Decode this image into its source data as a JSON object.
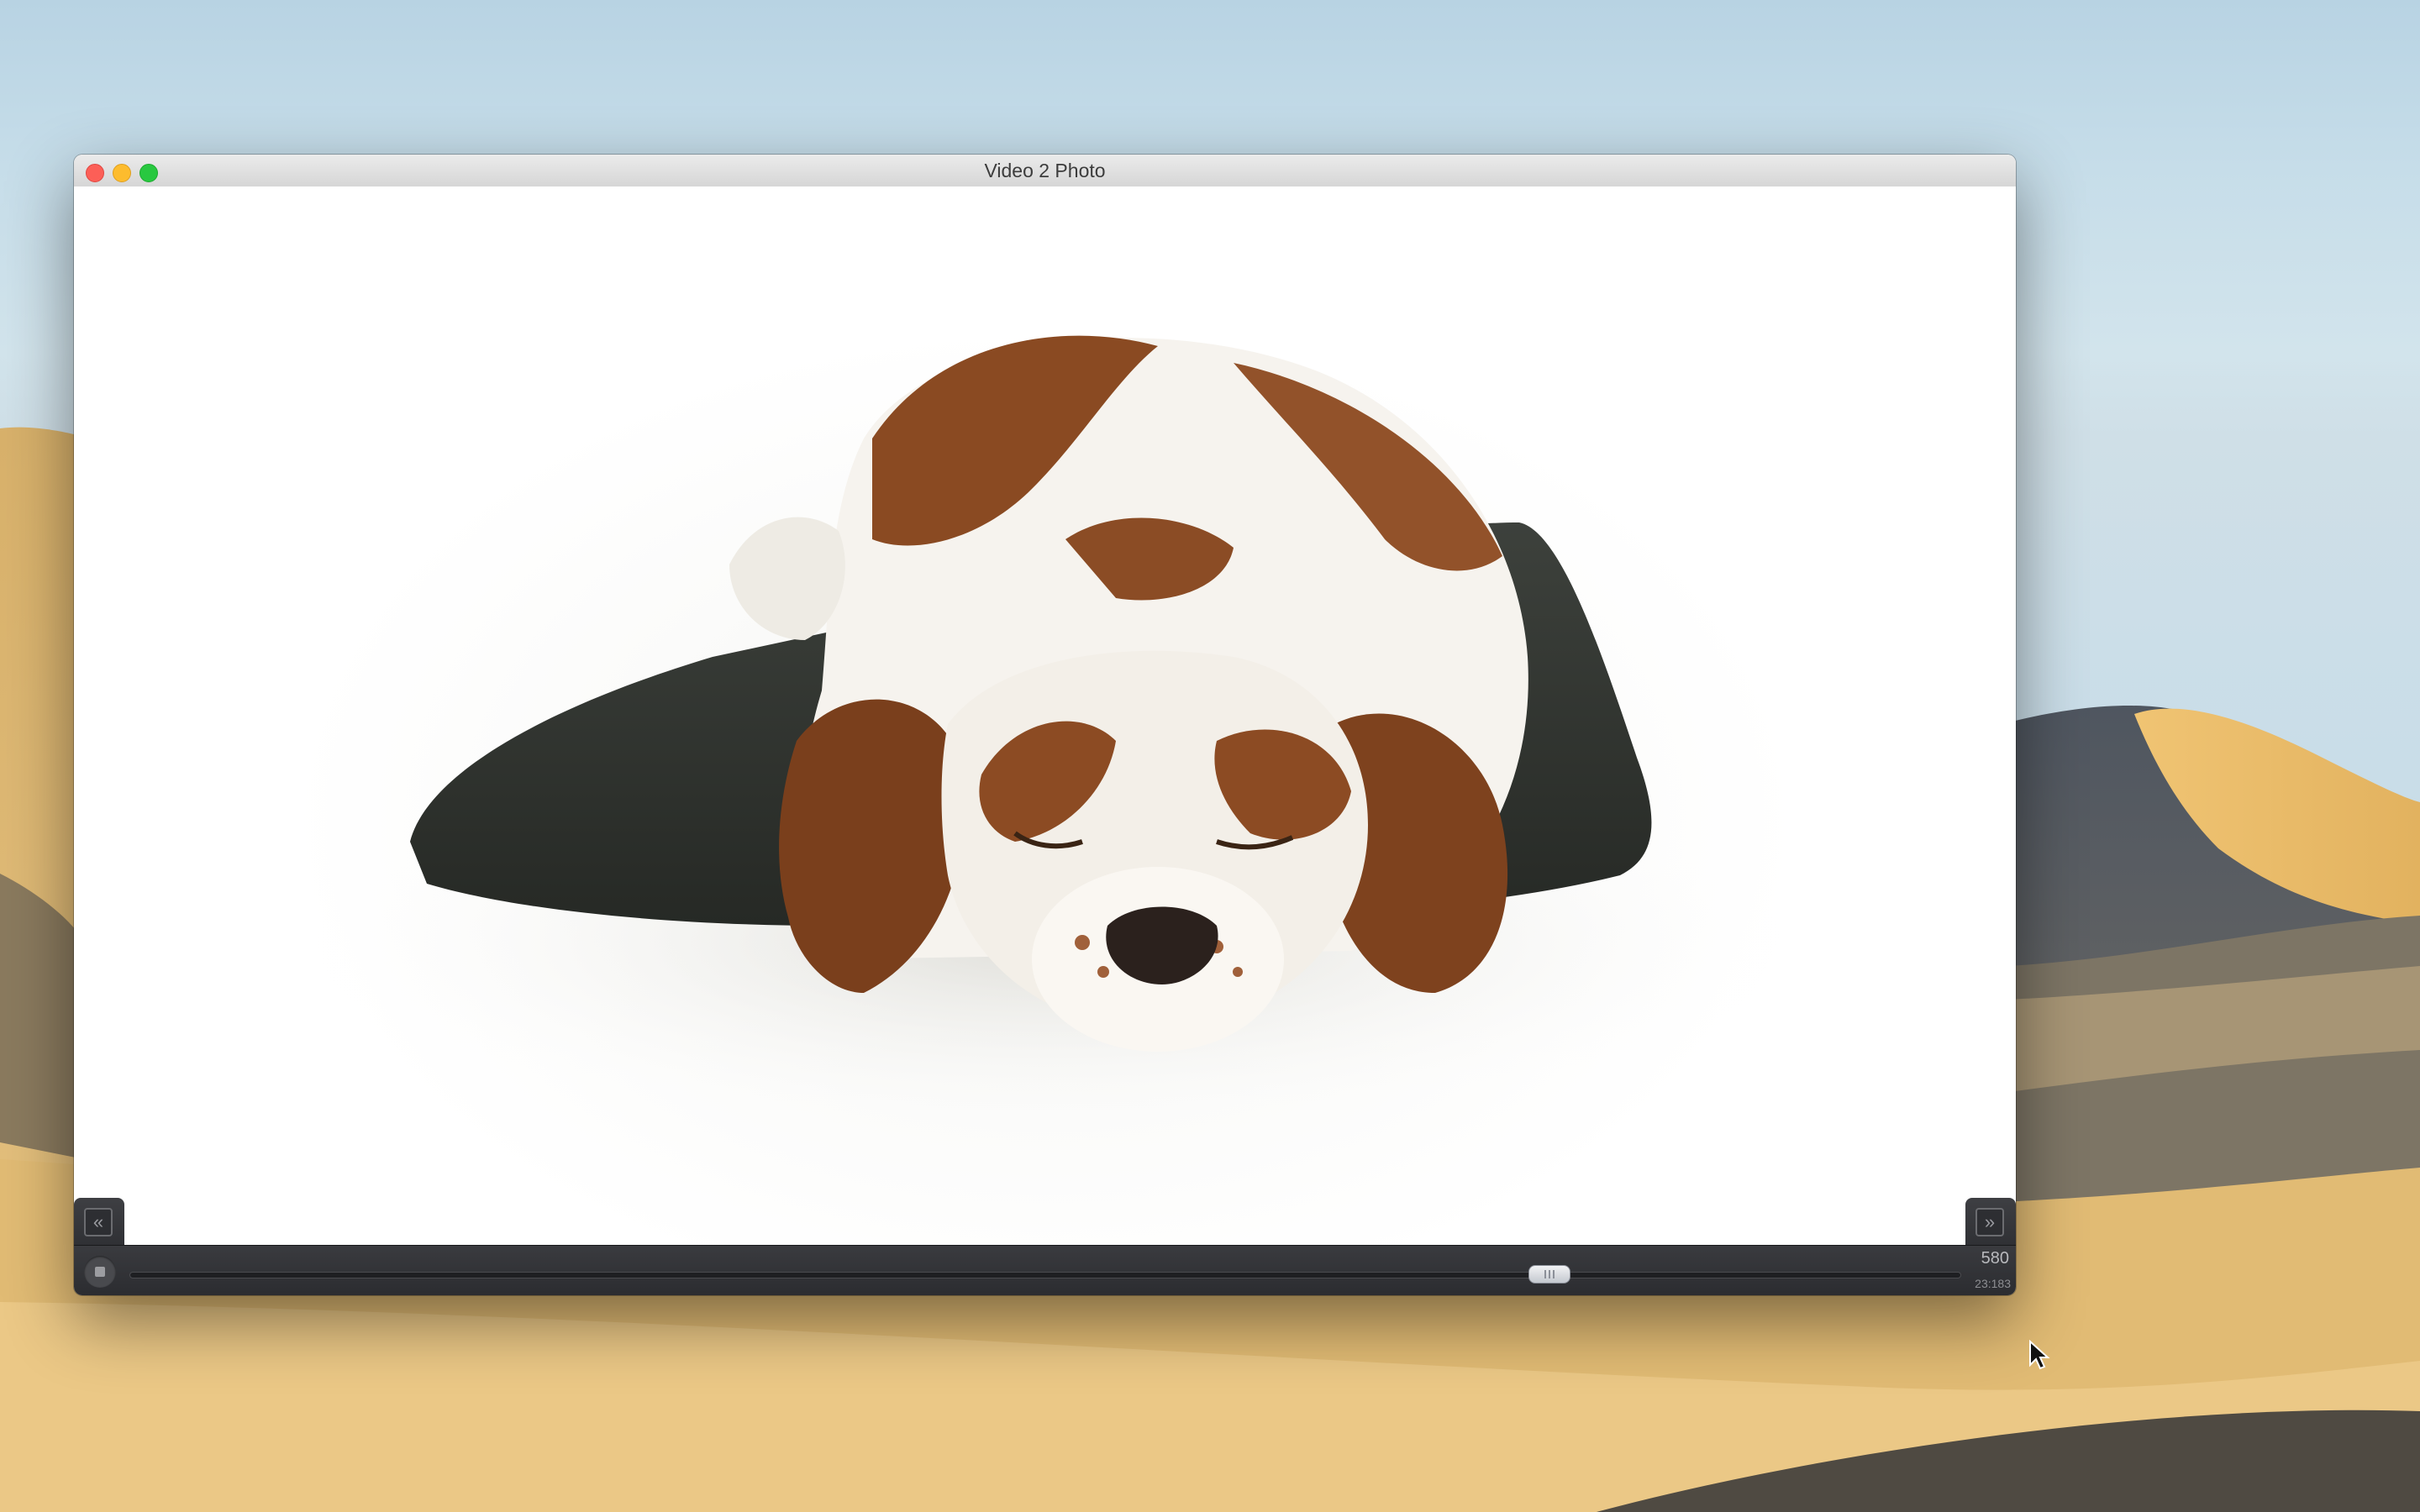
{
  "window": {
    "title": "Video 2 Photo"
  },
  "video": {
    "content": "sleeping-dog-on-pillow"
  },
  "controls": {
    "prev_label": "«",
    "next_label": "»",
    "frame_number": "580",
    "timecode": "23:183",
    "scrubber_position": 0.775
  },
  "colors": {
    "close": "#fc5f57",
    "minimize": "#fdbc2e",
    "maximize": "#28c840",
    "controls_bg": "#2b2c30"
  }
}
